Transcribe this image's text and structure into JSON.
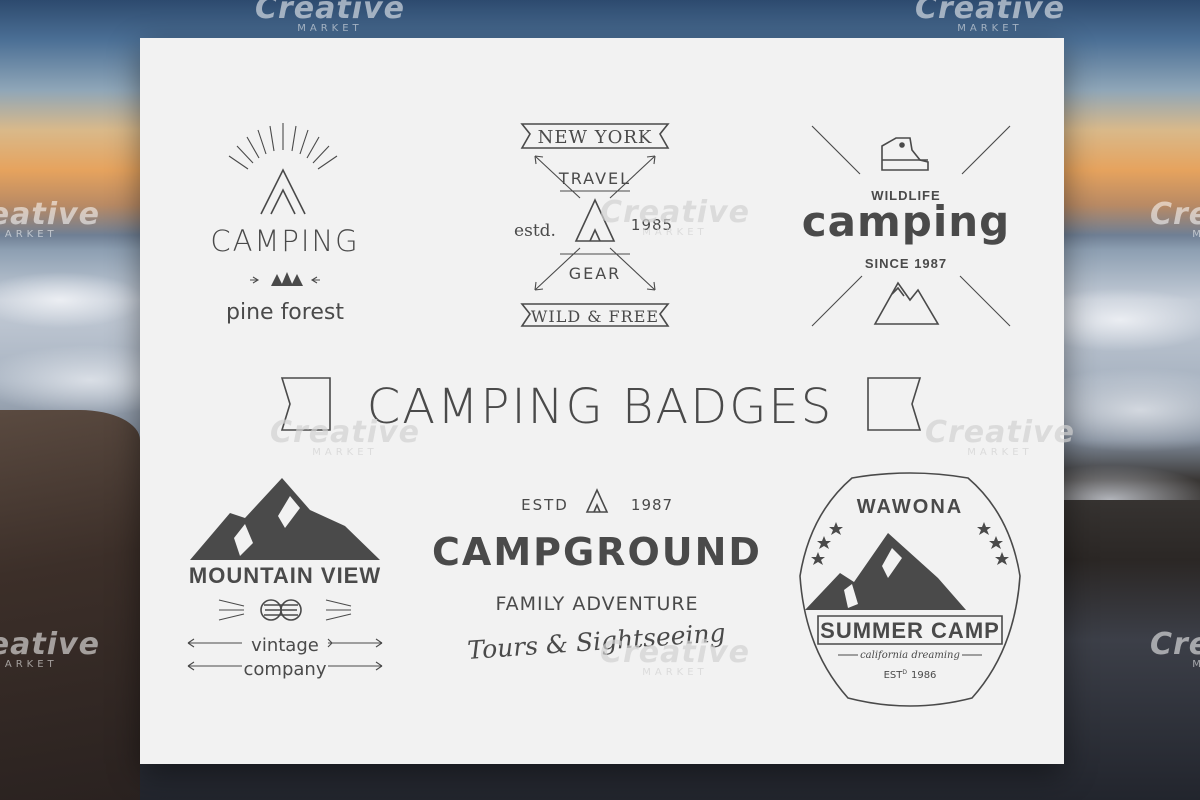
{
  "watermark": {
    "brand": "Creative",
    "sub": "MARKET"
  },
  "title": "CAMPING BADGES",
  "badges": {
    "b1": {
      "title": "CAMPING",
      "subtitle": "pine forest"
    },
    "b2": {
      "top": "NEW YORK",
      "travel": "TRAVEL",
      "estd": "estd.",
      "year": "1985",
      "gear": "GEAR",
      "bottom": "WILD & FREE"
    },
    "b3": {
      "top": "WILDLIFE",
      "title": "camping",
      "since": "SINCE 1987"
    },
    "b4": {
      "title": "MOUNTAIN VIEW",
      "line1": "vintage",
      "line2": "company"
    },
    "b5": {
      "estd": "ESTD",
      "year": "1987",
      "title": "CAMPGROUND",
      "sub": "FAMILY ADVENTURE",
      "tagline": "Tours & Sightseeing"
    },
    "b6": {
      "top": "WAWONA",
      "ribbon": "SUMMER CAMP",
      "script": "california dreaming",
      "est": "EST",
      "est_sup": "D",
      "year": "1986"
    }
  },
  "colors": {
    "ink": "#4a4a4a",
    "paper": "#f2f2f2"
  }
}
